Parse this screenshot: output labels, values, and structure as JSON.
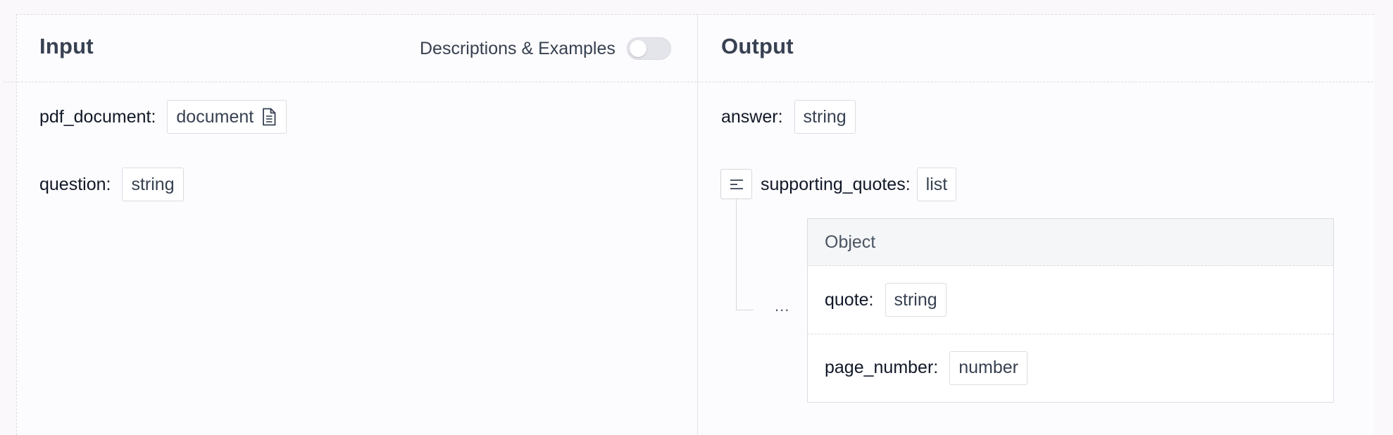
{
  "input_panel": {
    "title": "Input",
    "toggle": {
      "label": "Descriptions & Examples",
      "checked": false
    },
    "fields": [
      {
        "label": "pdf_document:",
        "type": "document",
        "icon": "document-icon"
      },
      {
        "label": "question:",
        "type": "string"
      }
    ]
  },
  "output_panel": {
    "title": "Output",
    "answer": {
      "label": "answer:",
      "type": "string"
    },
    "supporting_quotes": {
      "label": "supporting_quotes:",
      "type": "list",
      "toggle_icon": "list-lines-icon",
      "ellipsis": "...",
      "object": {
        "header": "Object",
        "fields": [
          {
            "label": "quote:",
            "type": "string"
          },
          {
            "label": "page_number:",
            "type": "number"
          }
        ]
      }
    }
  }
}
